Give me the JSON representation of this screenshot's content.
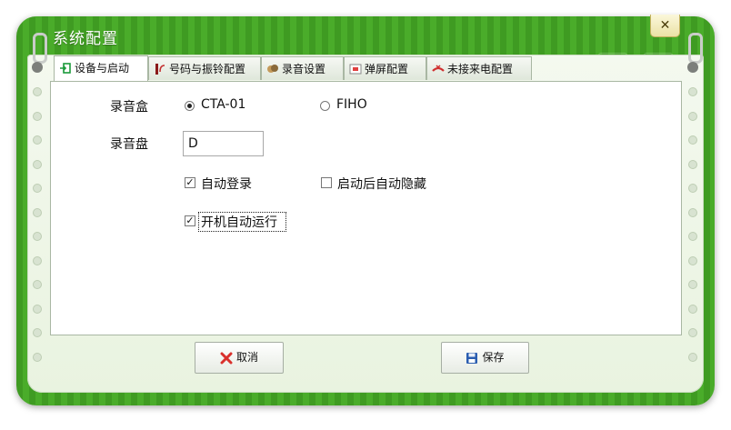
{
  "window": {
    "title": "系统配置",
    "close_label": "✕"
  },
  "tabs": [
    {
      "label": "设备与启动",
      "icon": "device-startup-icon"
    },
    {
      "label": "号码与振铃配置",
      "icon": "phone-ring-icon"
    },
    {
      "label": "录音设置",
      "icon": "recording-icon"
    },
    {
      "label": "弹屏配置",
      "icon": "popup-screen-icon"
    },
    {
      "label": "未接来电配置",
      "icon": "missed-call-icon"
    }
  ],
  "form": {
    "record_box_label": "录音盒",
    "record_box_options": [
      {
        "label": "CTA-01",
        "selected": true
      },
      {
        "label": "FIHO",
        "selected": false
      }
    ],
    "record_disk_label": "录音盘",
    "record_disk_value": "D",
    "auto_login_label": "自动登录",
    "auto_login_checked": true,
    "hide_after_start_label": "启动后自动隐藏",
    "hide_after_start_checked": false,
    "auto_start_label": "开机自动运行",
    "auto_start_checked": true
  },
  "buttons": {
    "cancel_label": "取消",
    "save_label": "保存"
  },
  "colors": {
    "frame_green": "#4aac2a",
    "close_button": "#f4eec4",
    "cancel_icon_red": "#d9302c",
    "save_icon_blue": "#2a5db0"
  }
}
